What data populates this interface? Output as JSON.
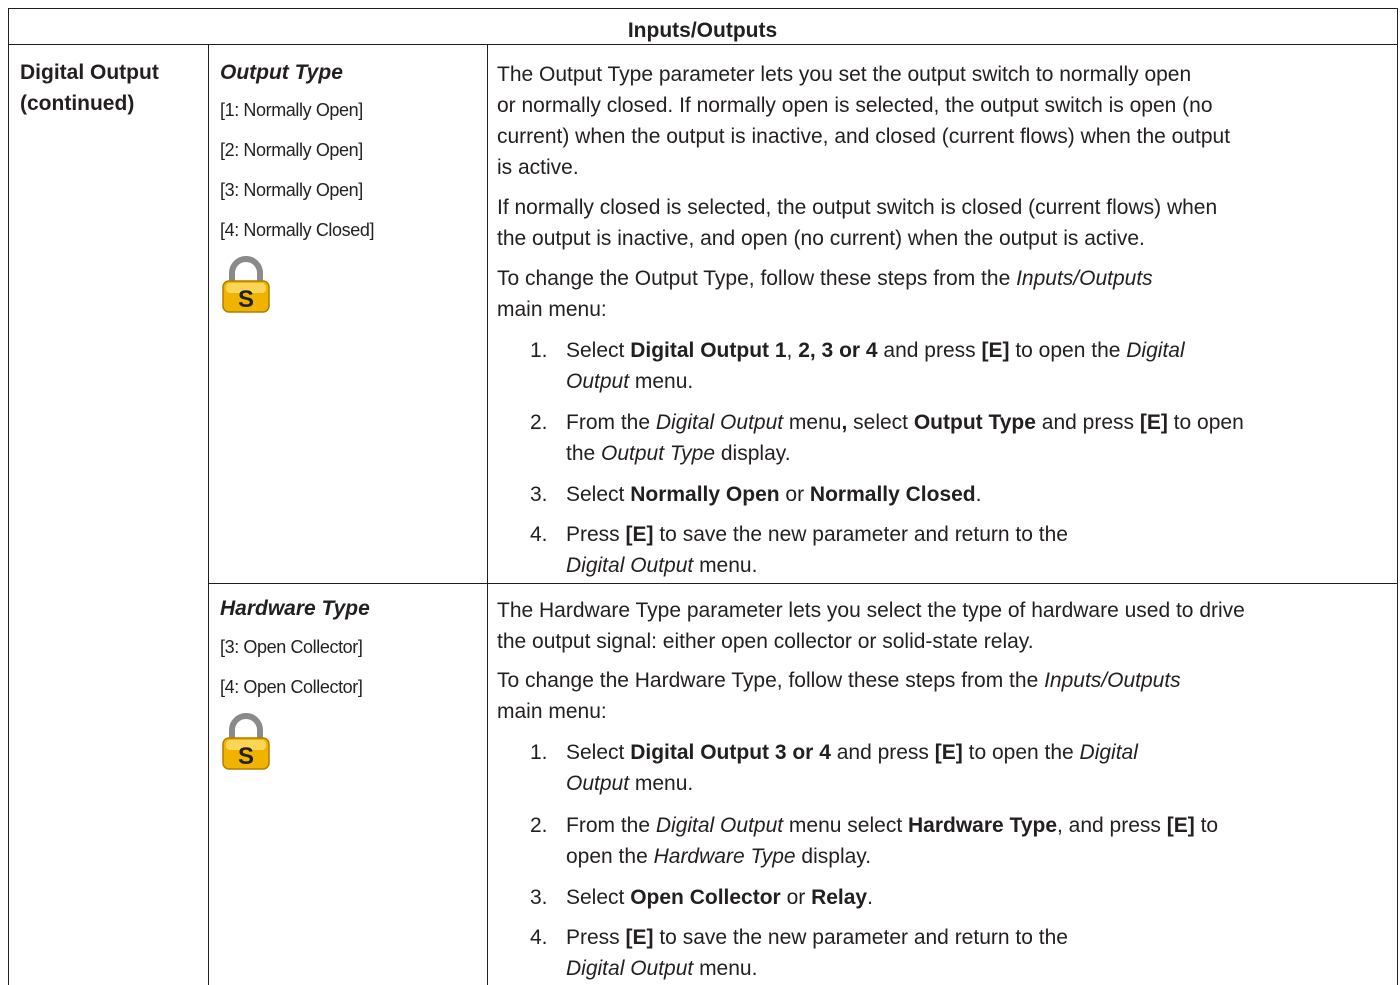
{
  "table_header": "Inputs/Outputs",
  "section": {
    "line1": "Digital Output",
    "line2": "(continued)"
  },
  "lock_letter": "S",
  "output_type": {
    "title": "Output Type",
    "options": [
      "[1: Normally Open]",
      "[2: Normally Open]",
      "[3: Normally Open]",
      "[4: Normally Closed]"
    ],
    "para1": [
      "The Output Type parameter lets you set the output switch to normally open",
      "or normally closed. If normally open is selected, the output switch is open (no",
      "current) when the output is inactive, and closed (current flows) when the output",
      "is active."
    ],
    "para2": [
      "If normally closed is selected, the output switch is closed (current flows) when",
      "the output is inactive, and open (no current) when the output is active."
    ],
    "intro": {
      "a": "To change the Output Type, follow these steps from the ",
      "a_em": "Inputs/Outputs",
      "b": "main menu:"
    },
    "steps": {
      "s1": {
        "num": "1.",
        "t1": "Select ",
        "b1": "Digital Output 1",
        "t2": ", ",
        "b2": "2, 3 or 4",
        "t3": " and press ",
        "b3": "[E]",
        "t4": " to open the ",
        "i1": "Digital",
        "i2": "Output",
        "t5": " menu."
      },
      "s2": {
        "num": "2.",
        "t1": "From the ",
        "i1": "Digital Output",
        "t2": " menu",
        "b1": ",",
        "t3": " select ",
        "b2": "Output Type",
        "t4": " and press ",
        "b3": "[E]",
        "t5": " to open",
        "t6": "the ",
        "i2": "Output Type",
        "t7": " display."
      },
      "s3": {
        "num": "3.",
        "t1": "Select ",
        "b1": "Normally Open",
        "t2": " or ",
        "b2": "Normally Closed",
        "t3": "."
      },
      "s4": {
        "num": "4.",
        "t1": "Press ",
        "b1": "[E]",
        "t2": " to save the new parameter and return to the",
        "i1": "Digital Output",
        "t3": " menu."
      }
    }
  },
  "hardware_type": {
    "title": "Hardware Type",
    "options": [
      "[3: Open Collector]",
      "[4: Open Collector]"
    ],
    "para1": [
      "The Hardware Type parameter lets you select the type of hardware used to drive",
      "the output signal: either open collector or solid-state relay."
    ],
    "intro": {
      "a": "To change the Hardware Type, follow these steps from the ",
      "a_em": "Inputs/Outputs",
      "b": "main menu:"
    },
    "steps": {
      "s1": {
        "num": "1.",
        "t1": "Select ",
        "b1": "Digital Output 3 or 4",
        "t2": " and press ",
        "b2": "[E]",
        "t3": " to open the ",
        "i1": "Digital",
        "i2": "Output",
        "t4": " menu."
      },
      "s2": {
        "num": "2.",
        "t1": "From the ",
        "i1": "Digital Output",
        "t2": " menu select ",
        "b1": "Hardware Type",
        "t3": ", and press ",
        "b2": "[E]",
        "t4": " to",
        "t5": "open the ",
        "i2": "Hardware Type",
        "t6": " display."
      },
      "s3": {
        "num": "3.",
        "t1": "Select ",
        "b1": "Open Collector",
        "t2": " or ",
        "b2": "Relay",
        "t3": "."
      },
      "s4": {
        "num": "4.",
        "t1": "Press ",
        "b1": "[E]",
        "t2": " to save the new parameter and return to the",
        "i1": "Digital Output",
        "t3": " menu."
      }
    }
  },
  "colors": {
    "border": "#231f20",
    "text": "#231f20",
    "lock_gold": "#f0b400",
    "lock_shackle": "#8a8a8a"
  }
}
